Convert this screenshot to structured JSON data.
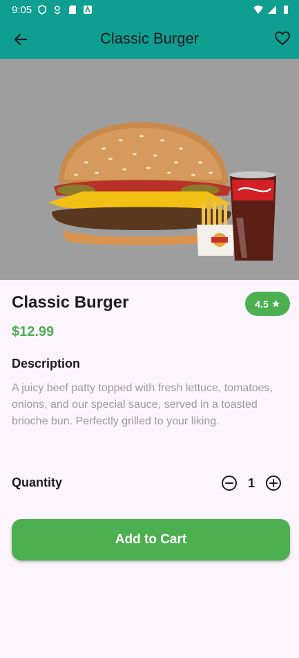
{
  "status_bar": {
    "time": "9:05",
    "left_icons": [
      "shield-icon",
      "location-icon",
      "sd-card-icon",
      "app-icon"
    ],
    "right_icons": [
      "wifi-icon",
      "signal-icon",
      "battery-icon"
    ]
  },
  "app_bar": {
    "title": "Classic Burger",
    "back_icon": "arrow-back-icon",
    "favorite_icon": "heart-outline-icon"
  },
  "product": {
    "name": "Classic Burger",
    "price": "$12.99",
    "rating": "4.5",
    "rating_icon": "star-icon",
    "image_label": "Burger meal with fries and soda"
  },
  "description": {
    "heading": "Description",
    "body": "A juicy beef patty topped with fresh lettuce, tomatoes, onions, and our special sauce, served in a toasted brioche bun. Perfectly grilled to your liking."
  },
  "quantity": {
    "label": "Quantity",
    "value": "1"
  },
  "actions": {
    "add_to_cart": "Add to Cart"
  },
  "colors": {
    "primary": "#0e9e92",
    "accent": "#4caf50",
    "background": "#fcf5fd",
    "text_muted": "#9a9a9a"
  }
}
